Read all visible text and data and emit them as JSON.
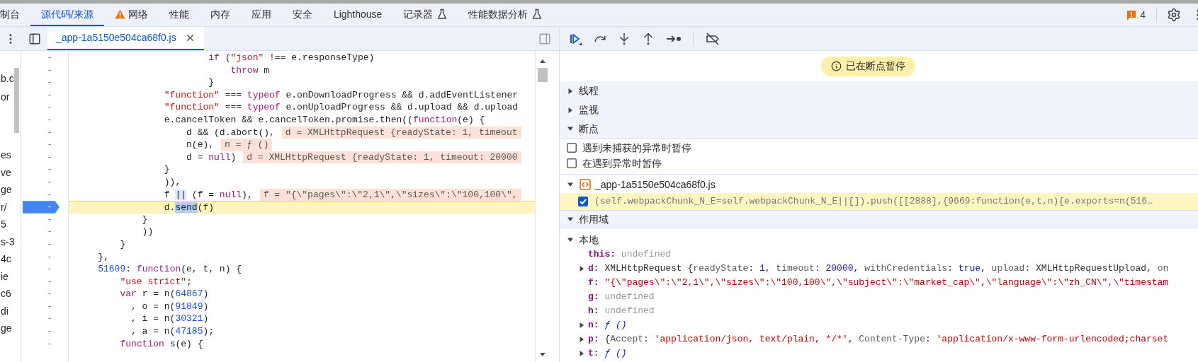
{
  "top_tabs": [
    {
      "label": "制台",
      "selected": false,
      "kind": "plain"
    },
    {
      "label": "源代码/来源",
      "selected": true,
      "kind": "plain"
    },
    {
      "label": "网络",
      "selected": false,
      "kind": "warning"
    },
    {
      "label": "性能",
      "selected": false,
      "kind": "plain"
    },
    {
      "label": "内存",
      "selected": false,
      "kind": "plain"
    },
    {
      "label": "应用",
      "selected": false,
      "kind": "plain"
    },
    {
      "label": "安全",
      "selected": false,
      "kind": "plain"
    },
    {
      "label": "Lighthouse",
      "selected": false,
      "kind": "plain"
    },
    {
      "label": "记录器",
      "selected": false,
      "kind": "experiment"
    },
    {
      "label": "性能数据分析",
      "selected": false,
      "kind": "experiment"
    }
  ],
  "issues": {
    "count": "4"
  },
  "sidebar_fragments": [
    "b.c",
    "or",
    "es",
    "ve",
    "ge",
    "r/",
    "5",
    "s-3",
    "4c",
    "ie",
    "c6",
    "di",
    "ge"
  ],
  "editor_tabs": [
    {
      "label": "_app-1a5150e504ca68f0.js",
      "selected": true
    }
  ],
  "code_lines": [
    {
      "gutter": "-",
      "current": false,
      "tokens": [
        {
          "text": "                        if",
          "kind": "keyword"
        },
        {
          "text": " (",
          "kind": "plain"
        },
        {
          "text": "\"json\"",
          "kind": "string"
        },
        {
          "text": " !== e.responseType)",
          "kind": "plain"
        }
      ]
    },
    {
      "gutter": "-",
      "current": false,
      "tokens": [
        {
          "text": "                            throw",
          "kind": "keyword"
        },
        {
          "text": " m",
          "kind": "plain"
        }
      ]
    },
    {
      "gutter": "-",
      "current": false,
      "tokens": [
        {
          "text": "                        }",
          "kind": "plain"
        }
      ]
    },
    {
      "gutter": "-",
      "current": false,
      "tokens": [
        {
          "text": "                \"function\"",
          "kind": "string"
        },
        {
          "text": " === ",
          "kind": "plain"
        },
        {
          "text": "typeof",
          "kind": "keyword"
        },
        {
          "text": " e.onDownloadProgress && d.addEventListener",
          "kind": "plain"
        }
      ]
    },
    {
      "gutter": "-",
      "current": false,
      "tokens": [
        {
          "text": "                \"function\"",
          "kind": "string"
        },
        {
          "text": " === ",
          "kind": "plain"
        },
        {
          "text": "typeof",
          "kind": "keyword"
        },
        {
          "text": " e.onUploadProgress && d.upload && d.upload",
          "kind": "plain"
        }
      ]
    },
    {
      "gutter": "-",
      "current": false,
      "tokens": [
        {
          "text": "                e.cancelToken && e.cancelToken.promise.then((",
          "kind": "plain"
        },
        {
          "text": "function",
          "kind": "keyword"
        },
        {
          "text": "(e) {",
          "kind": "plain"
        }
      ]
    },
    {
      "gutter": "-",
      "current": false,
      "tokens": [
        {
          "text": "                    d && (d.abort(),",
          "kind": "plain"
        }
      ],
      "inline": "d = XMLHttpRequest {readyState: 1, timeout"
    },
    {
      "gutter": "-",
      "current": false,
      "tokens": [
        {
          "text": "                    n(e),",
          "kind": "plain"
        }
      ],
      "inline": "n = ƒ ()"
    },
    {
      "gutter": "-",
      "current": false,
      "tokens": [
        {
          "text": "                    d = ",
          "kind": "plain"
        },
        {
          "text": "null",
          "kind": "keyword"
        },
        {
          "text": ")",
          "kind": "plain"
        }
      ],
      "inline": "d = XMLHttpRequest {readyState: 1, timeout: 20000"
    },
    {
      "gutter": "-",
      "current": false,
      "tokens": [
        {
          "text": "                }",
          "kind": "plain"
        }
      ]
    },
    {
      "gutter": "-",
      "current": false,
      "tokens": [
        {
          "text": "                )),",
          "kind": "plain"
        }
      ]
    },
    {
      "gutter": "-",
      "current": false,
      "tokens": [
        {
          "text": "                f ",
          "kind": "plain"
        },
        {
          "text": "||",
          "kind": "match"
        },
        {
          "text": " (f = ",
          "kind": "plain"
        },
        {
          "text": "null",
          "kind": "keyword"
        },
        {
          "text": "),",
          "kind": "plain"
        }
      ],
      "inline": "f = \"{\\\"pages\\\":\\\"2,1\\\",\\\"sizes\\\":\\\"100,100\\\","
    },
    {
      "gutter": "-",
      "current": true,
      "tokens": [
        {
          "text": "                d.",
          "kind": "plain"
        },
        {
          "text": "send",
          "kind": "selected"
        },
        {
          "text": "(f)",
          "kind": "plain"
        }
      ]
    },
    {
      "gutter": "-",
      "current": false,
      "tokens": [
        {
          "text": "            }",
          "kind": "plain"
        }
      ]
    },
    {
      "gutter": "-",
      "current": false,
      "tokens": [
        {
          "text": "            ))",
          "kind": "plain"
        }
      ]
    },
    {
      "gutter": "-",
      "current": false,
      "tokens": [
        {
          "text": "        }",
          "kind": "plain"
        }
      ]
    },
    {
      "gutter": "-",
      "current": false,
      "tokens": [
        {
          "text": "    },",
          "kind": "plain"
        }
      ]
    },
    {
      "gutter": "-",
      "current": false,
      "tokens": [
        {
          "text": "    51609",
          "kind": "number"
        },
        {
          "text": ": ",
          "kind": "plain"
        },
        {
          "text": "function",
          "kind": "keyword"
        },
        {
          "text": "(e, t, n) {",
          "kind": "plain"
        }
      ]
    },
    {
      "gutter": "-",
      "current": false,
      "tokens": [
        {
          "text": "        \"use strict\"",
          "kind": "string"
        },
        {
          "text": ";",
          "kind": "plain"
        }
      ]
    },
    {
      "gutter": "-",
      "current": false,
      "tokens": [
        {
          "text": "        var",
          "kind": "keyword"
        },
        {
          "text": " r = n(",
          "kind": "plain"
        },
        {
          "text": "64867",
          "kind": "number"
        },
        {
          "text": ")",
          "kind": "plain"
        }
      ]
    },
    {
      "gutter": "-",
      "current": false,
      "tokens": [
        {
          "text": "          , o = n(",
          "kind": "plain"
        },
        {
          "text": "91849",
          "kind": "number"
        },
        {
          "text": ")",
          "kind": "plain"
        }
      ]
    },
    {
      "gutter": "-",
      "current": false,
      "tokens": [
        {
          "text": "          , i = n(",
          "kind": "plain"
        },
        {
          "text": "30321",
          "kind": "number"
        },
        {
          "text": ")",
          "kind": "plain"
        }
      ]
    },
    {
      "gutter": "-",
      "current": false,
      "tokens": [
        {
          "text": "          , a = n(",
          "kind": "plain"
        },
        {
          "text": "47185",
          "kind": "number"
        },
        {
          "text": ");",
          "kind": "plain"
        }
      ]
    },
    {
      "gutter": "-",
      "current": false,
      "tokens": [
        {
          "text": "        function",
          "kind": "keyword"
        },
        {
          "text": " s(e) {",
          "kind": "plain"
        }
      ]
    }
  ],
  "paused_banner": "已在断点暂停",
  "sections": [
    {
      "title": "线程",
      "expanded": false
    },
    {
      "title": "监视",
      "expanded": false
    },
    {
      "title": "断点",
      "expanded": true
    }
  ],
  "exception_options": [
    {
      "label": "遇到未捕获的异常时暂停",
      "checked": false
    },
    {
      "label": "在遇到异常时暂停",
      "checked": false
    }
  ],
  "breakpoint_files": [
    {
      "name": "_app-1a5150e504ca68f0.js",
      "expanded": true,
      "breakpoints": [
        {
          "code": "(self.webpackChunk_N_E=self.webpackChunk_N_E||[]).push([[2888],{9669:function(e,t,n){e.exports=n(516…",
          "checked": true
        }
      ]
    }
  ],
  "scope": {
    "title": "作用域",
    "expanded": true,
    "groups": [
      {
        "title": "本地",
        "expanded": true,
        "properties": [
          {
            "label": "this:",
            "kind": "primitive",
            "value": [
              {
                "text": "undefined",
                "kind": "undefined"
              }
            ]
          },
          {
            "label": "d:",
            "kind": "object",
            "expanded": false,
            "value": [
              {
                "text": "XMLHttpRequest {",
                "kind": "plain"
              },
              {
                "text": "readyState",
                "kind": "key"
              },
              {
                "text": ": ",
                "kind": "plain"
              },
              {
                "text": "1",
                "kind": "number"
              },
              {
                "text": ", ",
                "kind": "plain"
              },
              {
                "text": "timeout",
                "kind": "key"
              },
              {
                "text": ": ",
                "kind": "plain"
              },
              {
                "text": "20000",
                "kind": "number"
              },
              {
                "text": ", ",
                "kind": "plain"
              },
              {
                "text": "withCredentials",
                "kind": "key"
              },
              {
                "text": ": ",
                "kind": "plain"
              },
              {
                "text": "true",
                "kind": "bool"
              },
              {
                "text": ", ",
                "kind": "plain"
              },
              {
                "text": "upload",
                "kind": "key"
              },
              {
                "text": ": ",
                "kind": "plain"
              },
              {
                "text": "XMLHttpRequestUpload",
                "kind": "plain"
              },
              {
                "text": ", ",
                "kind": "plain"
              },
              {
                "text": "on",
                "kind": "key"
              }
            ]
          },
          {
            "label": "f:",
            "kind": "primitive",
            "value": [
              {
                "text": "\"{\\\"pages\\\":\\\"2,1\\\",\\\"sizes\\\":\\\"100,100\\\",\\\"subject\\\":\\\"market_cap\\\",\\\"language\\\":\\\"zh_CN\\\",\\\"timestam",
                "kind": "string"
              }
            ]
          },
          {
            "label": "g:",
            "kind": "primitive",
            "value": [
              {
                "text": "undefined",
                "kind": "undefined"
              }
            ]
          },
          {
            "label": "h:",
            "kind": "primitive",
            "value": [
              {
                "text": "undefined",
                "kind": "undefined"
              }
            ]
          },
          {
            "label": "n:",
            "kind": "object",
            "expanded": false,
            "value": [
              {
                "text": "ƒ ()",
                "kind": "func"
              }
            ]
          },
          {
            "label": "p:",
            "kind": "object",
            "expanded": false,
            "value": [
              {
                "text": "{",
                "kind": "plain"
              },
              {
                "text": "Accept",
                "kind": "key"
              },
              {
                "text": ": ",
                "kind": "plain"
              },
              {
                "text": "'application/json, text/plain, */*'",
                "kind": "string"
              },
              {
                "text": ", ",
                "kind": "plain"
              },
              {
                "text": "Content-Type",
                "kind": "key"
              },
              {
                "text": ": ",
                "kind": "plain"
              },
              {
                "text": "'application/x-www-form-urlencoded;charset",
                "kind": "string"
              }
            ]
          },
          {
            "label": "t:",
            "kind": "object",
            "expanded": false,
            "value": [
              {
                "text": "ƒ ()",
                "kind": "func"
              }
            ]
          }
        ]
      }
    ]
  }
}
